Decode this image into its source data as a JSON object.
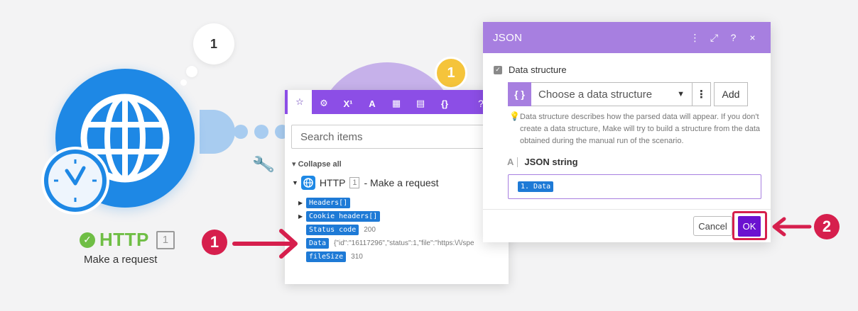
{
  "canvas": {
    "http_bubble_count": "1",
    "http_module": {
      "name": "HTTP",
      "badge": "1",
      "subtitle": "Make a request",
      "status": "success"
    },
    "json_module": {
      "operations_badge": "1"
    },
    "colors": {
      "http_blue": "#1e88e5",
      "success_green": "#6fbe45",
      "json_purple": "#a77fe0",
      "badge_yellow": "#f5c43b"
    }
  },
  "mapper": {
    "tabs": [
      {
        "icon": "star-icon",
        "label": "☆",
        "active": true
      },
      {
        "icon": "gear-icon",
        "label": "⚙"
      },
      {
        "icon": "superscript-icon",
        "label": "X¹"
      },
      {
        "icon": "text-icon",
        "label": "A"
      },
      {
        "icon": "calendar-icon",
        "label": "▦"
      },
      {
        "icon": "table-icon",
        "label": "▤"
      },
      {
        "icon": "braces-icon",
        "label": "{}"
      }
    ],
    "help": "?",
    "close": "×",
    "search_placeholder": "Search items",
    "collapse_all": "Collapse all",
    "module": {
      "name": "HTTP",
      "badge": "1",
      "label": "- Make a request"
    },
    "items": [
      {
        "name": "Headers[]",
        "value": "",
        "expandable": true
      },
      {
        "name": "Cookie headers[]",
        "value": "",
        "expandable": true
      },
      {
        "name": "Status code",
        "value": "200",
        "expandable": false
      },
      {
        "name": "Data",
        "value": "{\"id\":\"16117296\",\"status\":1,\"file\":\"https:\\/\\/spe",
        "expandable": false
      },
      {
        "name": "fileSize",
        "value": "310",
        "expandable": false
      }
    ]
  },
  "json_dialog": {
    "title": "JSON",
    "header_buttons": [
      "⋮",
      "⤢",
      "?",
      "×"
    ],
    "data_structure_label": "Data structure",
    "data_structure_placeholder": "Choose a data structure",
    "add_label": "Add",
    "help_text": "Data structure describes how the parsed data will appear. If you don't create a data structure, Make will try to build a structure from the data obtained during the manual run of the scenario.",
    "json_string_label": "JSON string",
    "json_string_value": "1. Data",
    "cancel_label": "Cancel",
    "ok_label": "OK"
  },
  "annotations": {
    "marker_1": "1",
    "marker_2": "2",
    "color": "#d61f4d"
  }
}
